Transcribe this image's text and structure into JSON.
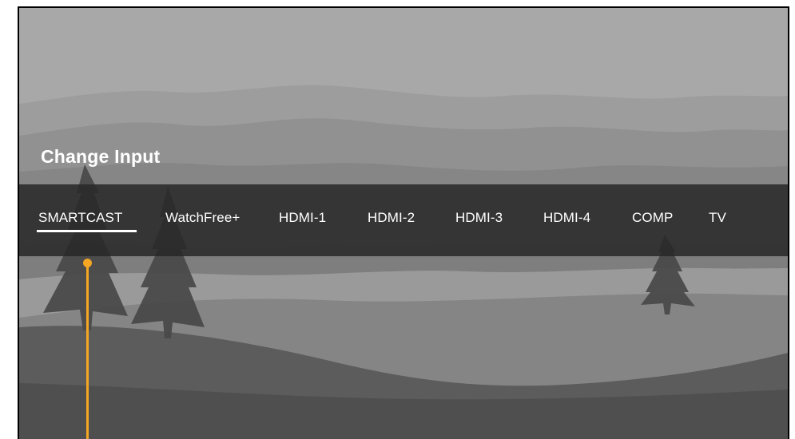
{
  "screen": {
    "title": "Change Input"
  },
  "inputs": [
    {
      "label": "SMARTCAST",
      "selected": true
    },
    {
      "label": "WatchFree+",
      "selected": false
    },
    {
      "label": "HDMI-1",
      "selected": false
    },
    {
      "label": "HDMI-2",
      "selected": false
    },
    {
      "label": "HDMI-3",
      "selected": false
    },
    {
      "label": "HDMI-4",
      "selected": false
    },
    {
      "label": "COMP",
      "selected": false
    },
    {
      "label": "TV",
      "selected": false
    }
  ],
  "colors": {
    "highlight": "#ffffff",
    "callout": "#f5a623",
    "bar_background": "#282828"
  },
  "icons": [
    "focus-callout-marker"
  ]
}
